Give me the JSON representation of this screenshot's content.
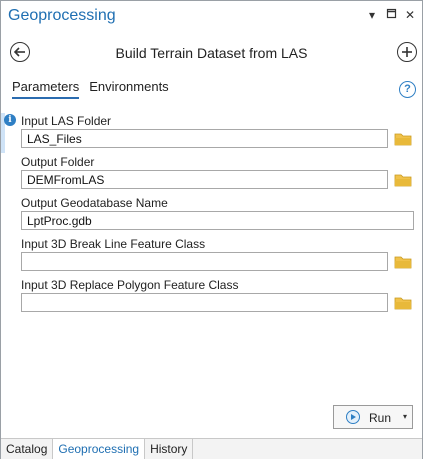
{
  "pane": {
    "title": "Geoprocessing",
    "icons": [
      "dropdown-icon",
      "pin-icon",
      "close-icon"
    ]
  },
  "tool": {
    "title": "Build Terrain Dataset from LAS",
    "back_icon": "back-arrow-icon",
    "add_icon": "add-icon"
  },
  "tabs": [
    "Parameters",
    "Environments"
  ],
  "help_glyph": "?",
  "info_glyph": "i",
  "params": [
    {
      "label": "Input LAS Folder",
      "value": "LAS_Files",
      "icon": "folder-icon"
    },
    {
      "label": "Output Folder",
      "value": "DEMFromLAS",
      "icon": "folder-icon"
    },
    {
      "label": "Output Geodatabase Name",
      "value": "LptProc.gdb"
    },
    {
      "label": "Input 3D Break Line Feature Class",
      "value": "",
      "icon": "folder-icon"
    },
    {
      "label": "Input 3D Replace Polygon Feature Class",
      "value": "",
      "icon": "folder-icon"
    }
  ],
  "run": {
    "label": "Run",
    "caret": "▾"
  },
  "bottom_tabs": [
    "Catalog",
    "Geoprocessing",
    "History"
  ],
  "colors": {
    "accent": "#1f6fb2",
    "folder": "#e8b93a"
  }
}
